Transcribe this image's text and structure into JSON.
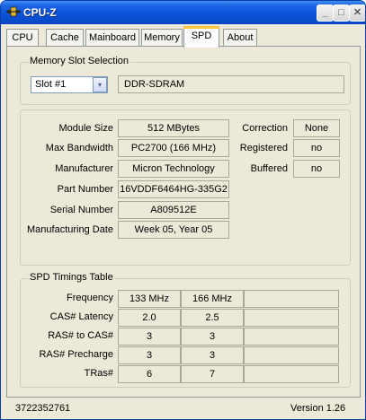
{
  "window": {
    "title": "CPU-Z",
    "min_label": "_",
    "max_label": "□",
    "close_label": "✕"
  },
  "tabs": [
    {
      "label": "CPU"
    },
    {
      "label": "Cache"
    },
    {
      "label": "Mainboard"
    },
    {
      "label": "Memory"
    },
    {
      "label": "SPD",
      "active": true
    },
    {
      "label": "About"
    }
  ],
  "memory_slot": {
    "group_title": "Memory Slot Selection",
    "slot_value": "Slot #1",
    "dropdown_glyph": "▾",
    "memory_type": "DDR-SDRAM"
  },
  "module": {
    "module_size_label": "Module Size",
    "module_size": "512 MBytes",
    "max_bandwidth_label": "Max Bandwidth",
    "max_bandwidth": "PC2700 (166 MHz)",
    "manufacturer_label": "Manufacturer",
    "manufacturer": "Micron Technology",
    "part_number_label": "Part Number",
    "part_number": "16VDDF6464HG-335G2",
    "serial_number_label": "Serial Number",
    "serial_number": "A809512E",
    "manufacturing_date_label": "Manufacturing Date",
    "manufacturing_date": "Week 05, Year 05",
    "correction_label": "Correction",
    "correction": "None",
    "registered_label": "Registered",
    "registered": "no",
    "buffered_label": "Buffered",
    "buffered": "no"
  },
  "timings": {
    "group_title": "SPD Timings Table",
    "rows": [
      {
        "label": "Frequency",
        "values": [
          "133 MHz",
          "166 MHz",
          ""
        ]
      },
      {
        "label": "CAS# Latency",
        "values": [
          "2.0",
          "2.5",
          ""
        ]
      },
      {
        "label": "RAS# to CAS#",
        "values": [
          "3",
          "3",
          ""
        ]
      },
      {
        "label": "RAS# Precharge",
        "values": [
          "3",
          "3",
          ""
        ]
      },
      {
        "label": "TRas#",
        "values": [
          "6",
          "7",
          ""
        ]
      }
    ]
  },
  "footer": {
    "id_text": "3722352761",
    "version": "Version 1.26"
  }
}
